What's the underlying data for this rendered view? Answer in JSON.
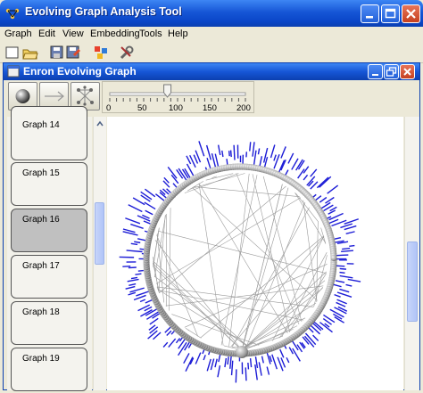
{
  "app": {
    "title": "Evolving Graph Analysis Tool"
  },
  "menu": [
    {
      "label": "Graph"
    },
    {
      "label": "Edit"
    },
    {
      "label": "View"
    },
    {
      "label": "Embedding"
    },
    {
      "label": "Tools"
    },
    {
      "label": "Help"
    }
  ],
  "toolbar": {
    "icons": [
      "new-icon",
      "open-icon",
      "save-icon",
      "save-as-icon",
      "layout-icon",
      "tools-icon"
    ]
  },
  "document": {
    "title": "Enron Evolving Graph"
  },
  "controls": {
    "buttons": [
      "sphere-icon",
      "arrow-icon",
      "graph-layout-icon"
    ],
    "slider": {
      "min": 0,
      "max": 200,
      "value": 85,
      "tick_labels": [
        "0",
        "50",
        "100",
        "150",
        "200"
      ]
    }
  },
  "graphs": [
    {
      "label": "Graph 14",
      "selected": false
    },
    {
      "label": "Graph 15",
      "selected": false
    },
    {
      "label": "Graph 16",
      "selected": true
    },
    {
      "label": "Graph 17",
      "selected": false
    },
    {
      "label": "Graph 18",
      "selected": false
    },
    {
      "label": "Graph 19",
      "selected": false
    }
  ],
  "colors": {
    "title_bar": "#0b46c8",
    "node_labels": "#1c1cd6",
    "ring": "#9a9a9a",
    "edges": "#9a9a9a",
    "selected_item": "#c0c0c0"
  }
}
